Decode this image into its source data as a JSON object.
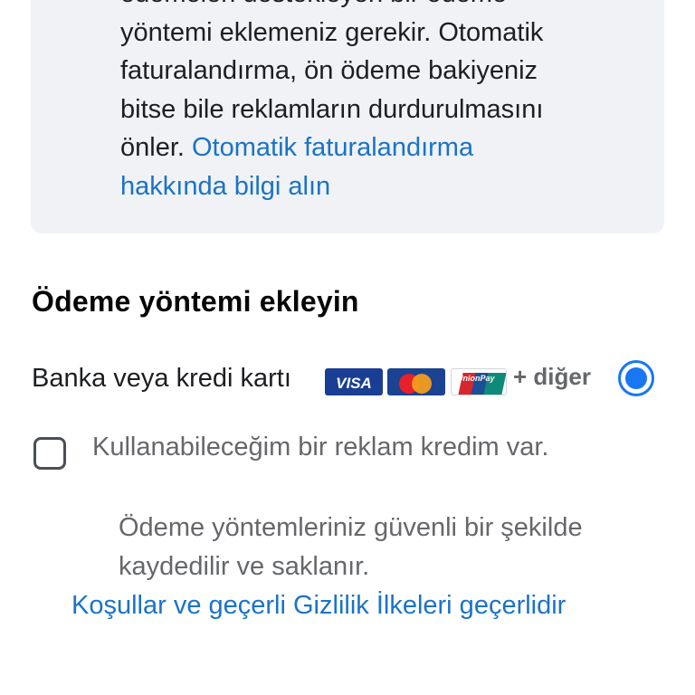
{
  "info": {
    "line_0": "ödemeleri destekleyen bir ödeme",
    "line_1": "yöntemi eklemeniz gerekir. Otomatik",
    "line_2": "faturalandırma, ön ödeme bakiyeniz",
    "line_3": "bitse bile reklamların durdurulmasını",
    "line_4_text": "önler. ",
    "link_part1": "Otomatik faturalandırma",
    "link_part2": "hakkında bilgi alın"
  },
  "payment_section": {
    "title": "Ödeme yöntemi ekleyin",
    "card_option": {
      "label": "Banka veya kredi kartı",
      "logos": {
        "visa": "VISA",
        "mastercard": "mastercard-logo",
        "unionpay": "UnionPay"
      },
      "more_text": "+ diğer",
      "selected": true
    },
    "credit_option": {
      "label": "Kullanabileceğim bir reklam kredim var.",
      "checked": false
    }
  },
  "footer": {
    "secure_line_1": "Ödeme yöntemleriniz güvenli bir şekilde",
    "secure_line_2": "kaydedilir ve saklanır.",
    "terms_link": "Koşullar ve geçerli Gizlilik İlkeleri geçerlidir"
  },
  "colors": {
    "accent": "#1877f2",
    "link": "#1a73c8",
    "info_bg": "#f0f2f5",
    "secondary_text": "#65676b"
  }
}
